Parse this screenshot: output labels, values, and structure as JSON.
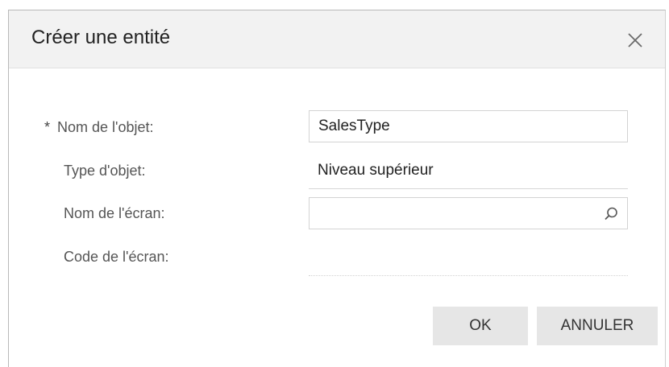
{
  "dialog": {
    "title": "Créer une entité",
    "close_icon": "close-icon"
  },
  "form": {
    "object_name": {
      "required_marker": "*",
      "label": "Nom de l'objet:",
      "value": "SalesType"
    },
    "object_type": {
      "label": "Type d'objet:",
      "value": "Niveau supérieur"
    },
    "screen_name": {
      "label": "Nom de l'écran:",
      "value": "",
      "icon": "search-icon"
    },
    "screen_code": {
      "label": "Code de l'écran:",
      "value": ""
    }
  },
  "buttons": {
    "ok_label": "OK",
    "cancel_label": "ANNULER"
  },
  "colors": {
    "header_bg": "#f2f2f2",
    "button_bg": "#e6e6e6",
    "label_text": "#555555",
    "value_text": "#222222"
  }
}
